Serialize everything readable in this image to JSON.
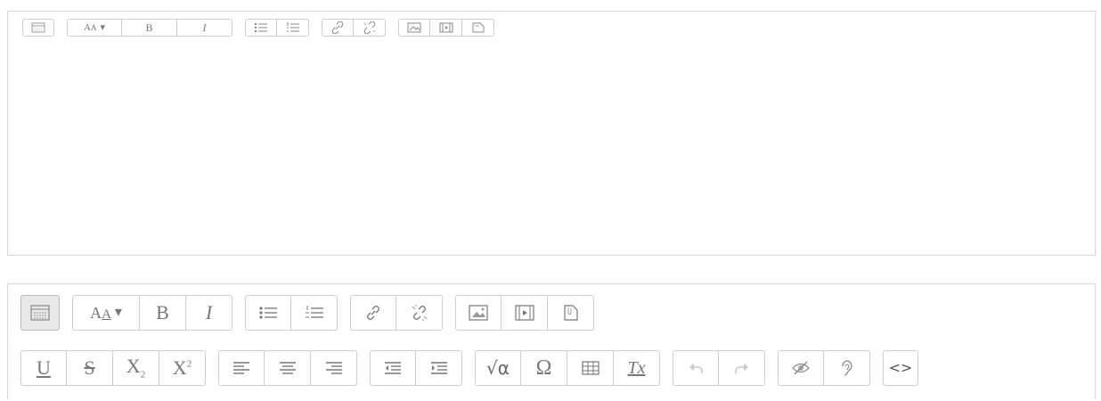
{
  "toolbar": {
    "show_more": "show-more-buttons-icon",
    "paragraph_styles": {
      "glyph": "A",
      "sub": "A",
      "caret": "▾"
    },
    "bold": "B",
    "italic": "I",
    "underline": "U",
    "strikethrough": "S",
    "subscript": {
      "base": "X",
      "script": "2"
    },
    "superscript": {
      "base": "X",
      "script": "2"
    },
    "equation": "√α",
    "special_char": "Ω",
    "clear_format": "Tx",
    "html": "<>"
  },
  "states": {
    "undo": "disabled",
    "redo": "disabled"
  }
}
